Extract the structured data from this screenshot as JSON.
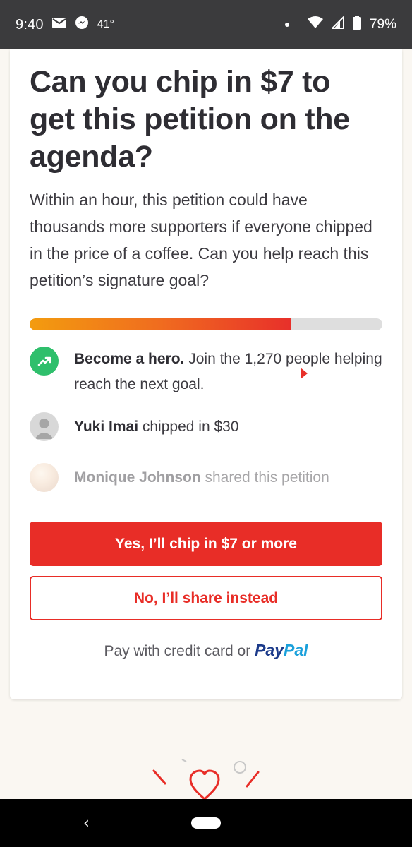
{
  "status_bar": {
    "time": "9:40",
    "temperature": "41°",
    "battery": "79%",
    "battery_level": 0.79
  },
  "card": {
    "headline": "Can you chip in $7 to get this petition on the agenda?",
    "body": "Within an hour, this petition could have thousands more supporters if everyone chipped in the price of a coffee. Can you help reach this petition’s signature goal?",
    "progress": 0.76,
    "feed": [
      {
        "bold": "Become a hero.",
        "text": " Join the 1,270 people helping reach the next goal.",
        "icon": "trending-up-icon"
      },
      {
        "bold": "Yuki Imai",
        "text": " chipped in $30",
        "icon": "avatar"
      },
      {
        "bold": "Monique Johnson",
        "text": " shared this petition",
        "icon": "avatar-photo"
      }
    ],
    "primary_button": "Yes, I’ll chip in $7 or more",
    "secondary_button": "No, I’ll share instead",
    "pay_prefix": "Pay with credit card or ",
    "paypal_part1": "Pay",
    "paypal_part2": "Pal"
  },
  "colors": {
    "accent": "#e82d27",
    "success": "#2fbf6c",
    "status_bar": "#3b3b3d"
  }
}
